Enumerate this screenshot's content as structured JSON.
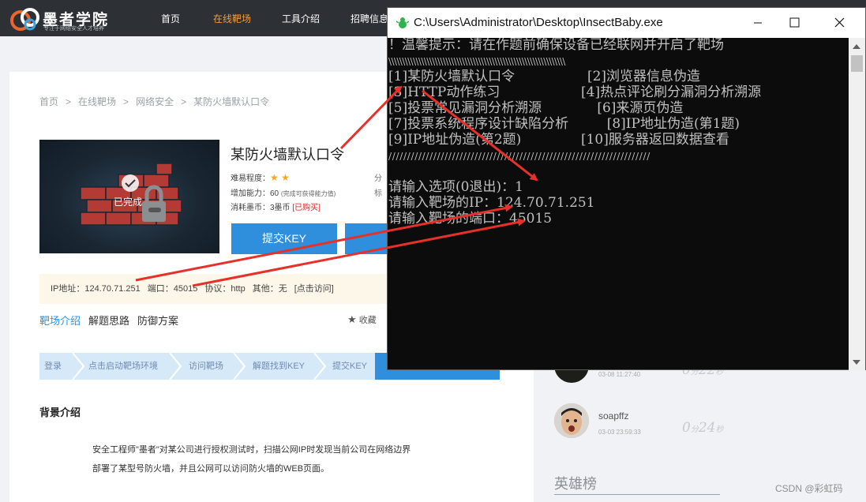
{
  "header": {
    "logo_name": "墨者学院",
    "logo_slogan": "专注于网络安全人才培养",
    "nav": [
      "首页",
      "在线靶场",
      "工具介绍",
      "招聘信息"
    ]
  },
  "breadcrumb": [
    "首页",
    "在线靶场",
    "网络安全",
    "某防火墙默认口令"
  ],
  "target": {
    "title": "某防火墙默认口令",
    "done_label": "已完成",
    "difficulty_label": "难易程度：",
    "ability_label": "增加能力：",
    "ability_value": "60",
    "ability_note": "(完成可获得能力值)",
    "cost_label": "消耗墨币：",
    "cost_value": "3墨币",
    "cost_status": "[已购买]",
    "right_label_1": "分",
    "right_label_2": "标",
    "submit_label": "提交KEY"
  },
  "ip_bar": {
    "ip": "IP地址：124.70.71.251",
    "port": "端口：45015",
    "protocol": "协议：http",
    "other": "其他：无",
    "link": "[点击访问]"
  },
  "tabs": [
    "靶场介绍",
    "解题思路",
    "防御方案"
  ],
  "collect_label": "收藏",
  "steps": [
    "登录",
    "点击启动靶场环境",
    "访问靶场",
    "解题找到KEY",
    "提交KEY"
  ],
  "background": {
    "title": "背景介绍",
    "line1": "安全工程师\"墨者\"对某公司进行授权测试时，扫描公网IP时发现当前公司在网络边界",
    "line2": "部署了某型号防火墙，并且公网可以访问防火墙的WEB页面。"
  },
  "ranking": [
    {
      "name": "",
      "date": "03-08 11:27:40",
      "time_num": "0",
      "time_unit1": "分",
      "time_num2": "22",
      "time_unit2": "秒"
    },
    {
      "name": "soapffz",
      "date": "03-03 23:59:33",
      "time_num": "0",
      "time_unit1": "分",
      "time_num2": "24",
      "time_unit2": "秒"
    }
  ],
  "heroes_title": "英雄榜",
  "watermark": "CSDN @彩虹码",
  "console": {
    "title": "C:\\Users\\Administrator\\Desktop\\InsectBaby.exe",
    "lines": [
      "！温馨提示：请在作题前确保设备已经联网并开启了靶场",
      "\\\\\\\\\\\\\\\\\\\\\\\\\\\\\\\\\\\\\\\\\\\\\\\\\\\\\\\\\\\\\\\\\\\\\\\\\\\\\\\\\\\\\\\\\\\\\\\\\\\\\\\\\\\\\\\\\\\\\\\\\\\\\\\\\\",
      "[1]某防火墙默认口令                 [2]浏览器信息伪造",
      "[3]HTTP动作练习                   [4]热点评论刷分漏洞分析溯源",
      "[5]投票常见漏洞分析溯源             [6]来源页伪造",
      "[7]投票系统程序设计缺陷分析         [8]IP地址伪造(第1题)",
      "[9]IP地址伪造(第2题)              [10]服务器返回数据查看",
      "//////////////////////////////////////////////////////////////////////",
      "",
      "请输入选项(0退出)：1",
      "请输入靶场的IP：124.70.71.251",
      "请输入靶场的端口：45015"
    ]
  },
  "colors": {
    "accent_blue": "#2f8fdc",
    "nav_active": "#f39c3d",
    "arrow_red": "#e8302a",
    "header_bg": "#2d3035"
  }
}
